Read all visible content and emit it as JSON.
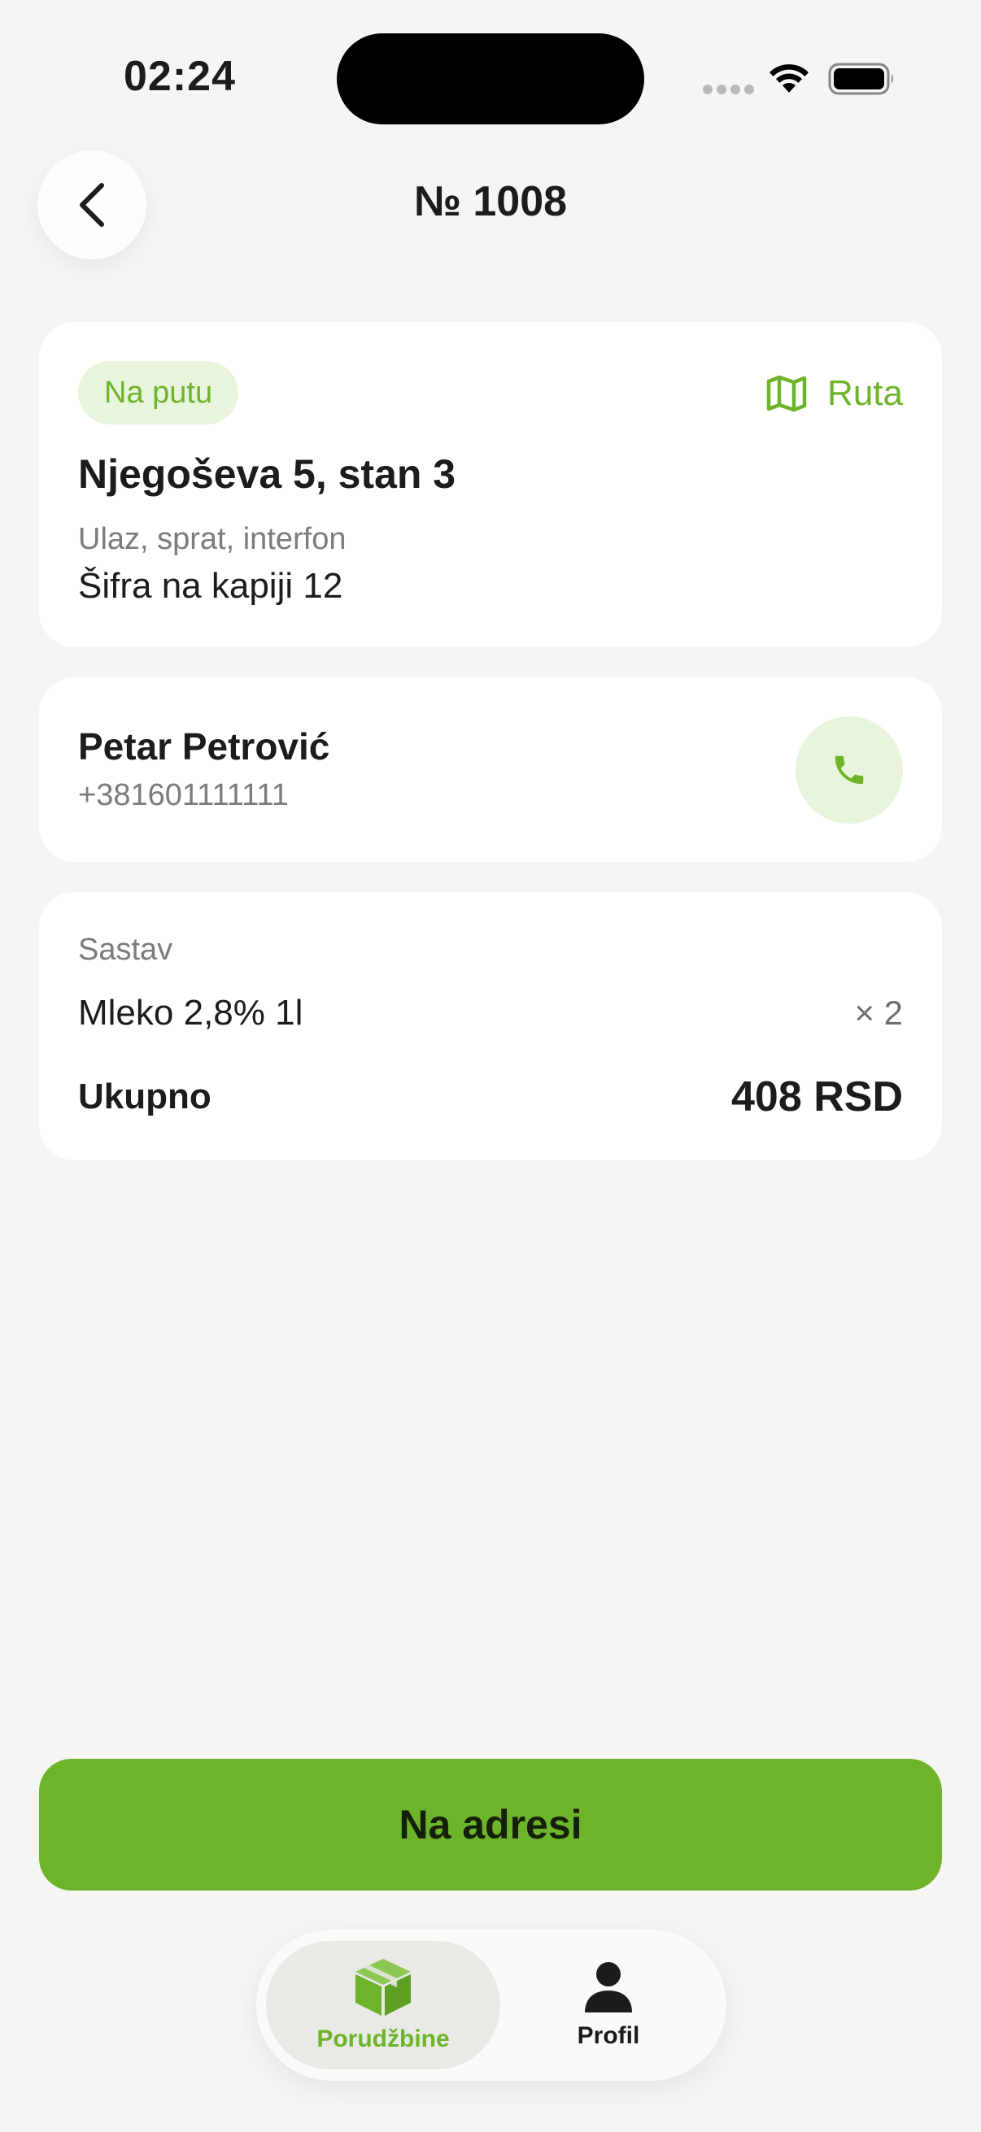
{
  "status_bar": {
    "time": "02:24"
  },
  "header": {
    "title": "№ 1008"
  },
  "address_card": {
    "status_badge": "Na putu",
    "route_label": "Ruta",
    "address": "Njegoševa 5, stan 3",
    "entry_label": "Ulaz, sprat, interfon",
    "entry_value": "Šifra na kapiji 12"
  },
  "customer_card": {
    "name": "Petar Petrović",
    "phone": "+381601111111"
  },
  "order_card": {
    "section_label": "Sastav",
    "items": [
      {
        "name": "Mleko 2,8% 1l",
        "quantity": "× 2"
      }
    ],
    "total_label": "Ukupno",
    "total_value": "408 RSD"
  },
  "primary_action": {
    "label": "Na adresi"
  },
  "tab_bar": {
    "tabs": [
      {
        "label": "Porudžbine",
        "icon": "package-icon",
        "active": true
      },
      {
        "label": "Profil",
        "icon": "person-icon",
        "active": false
      }
    ]
  },
  "colors": {
    "accent": "#6db42a",
    "accent_soft": "#e9f4dd",
    "background": "#f5f5f3",
    "card": "#ffffff",
    "muted_text": "#7b7b80"
  }
}
